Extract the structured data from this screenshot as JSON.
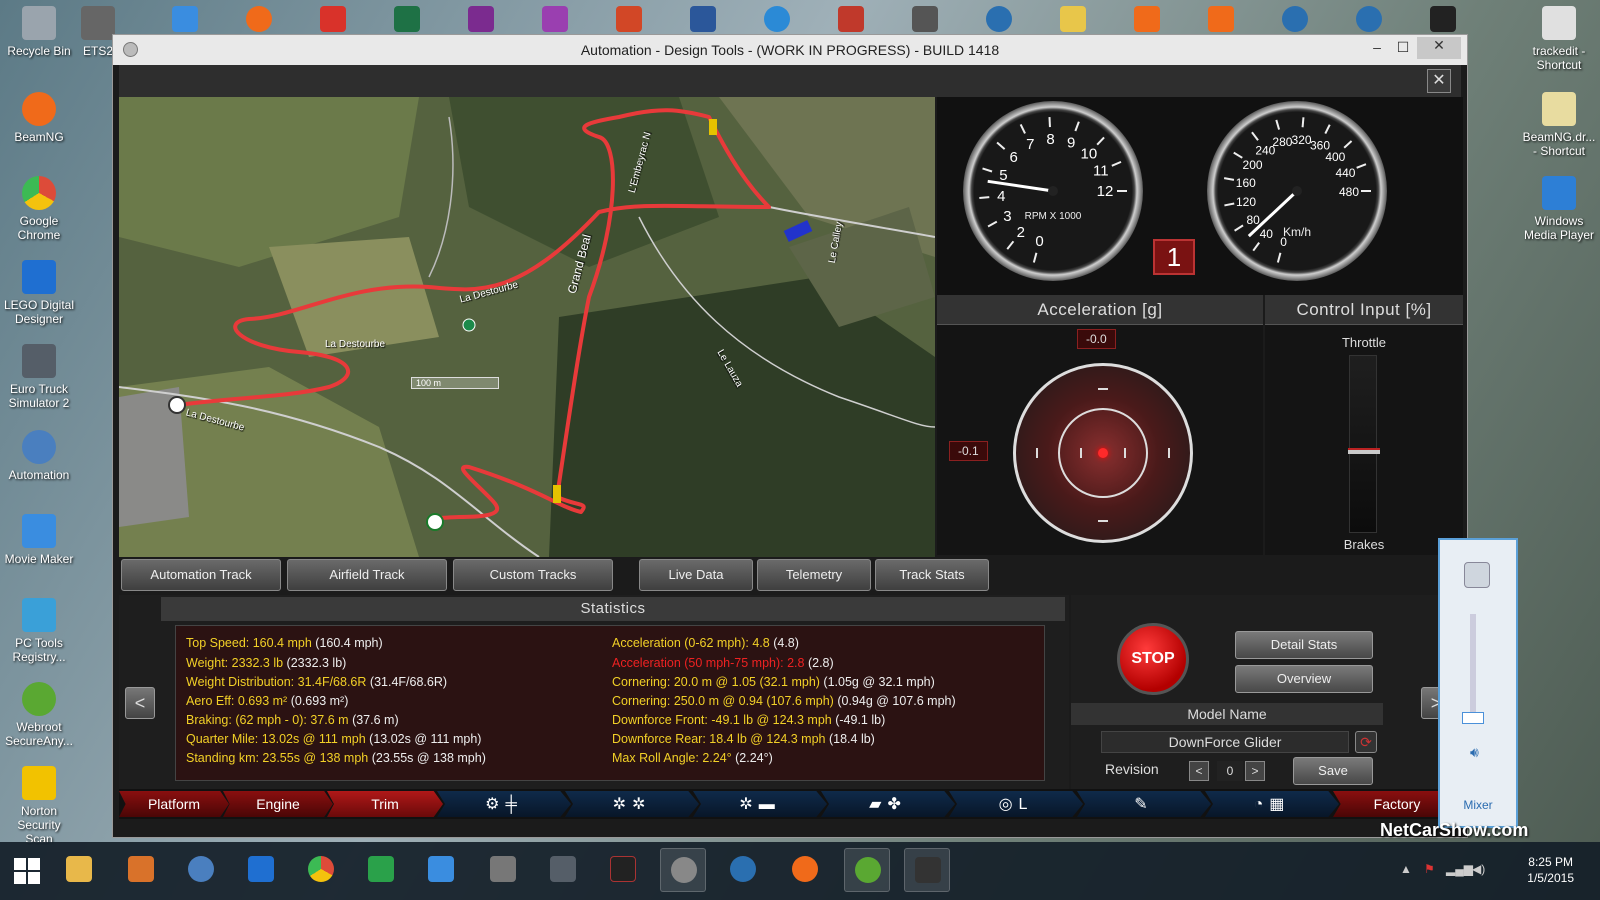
{
  "desktop": {
    "left_icons": [
      {
        "label": "Recycle Bin",
        "icon": "recycle-bin-icon",
        "color": "#9aa4ad"
      },
      {
        "label": "BeamNG",
        "icon": "beamng-icon",
        "color": "#f06a1a"
      },
      {
        "label": "Google Chrome",
        "icon": "chrome-icon",
        "color": "#dd4b39"
      },
      {
        "label": "LEGO Digital Designer",
        "icon": "lego-icon",
        "color": "#1f6fd1"
      },
      {
        "label": "Euro Truck Simulator 2",
        "icon": "truck-icon",
        "color": "#555e68"
      },
      {
        "label": "Automation",
        "icon": "automation-icon",
        "color": "#4a7fbf"
      },
      {
        "label": "Movie Maker",
        "icon": "movie-maker-icon",
        "color": "#3a8de0"
      },
      {
        "label": "PC Tools Registry...",
        "icon": "pc-tools-icon",
        "color": "#3aa0d8"
      },
      {
        "label": "Webroot SecureAny...",
        "icon": "webroot-icon",
        "color": "#5aa832"
      },
      {
        "label": "Norton Security Scan",
        "icon": "norton-icon",
        "color": "#f2c200"
      }
    ],
    "right_icons": [
      {
        "label": "trackedit - Shortcut",
        "icon": "trackedit-icon",
        "color": "#e0e0e0"
      },
      {
        "label": "BeamNG.dr... - Shortcut",
        "icon": "document-icon",
        "color": "#e8dca0"
      },
      {
        "label": "Windows Media Player",
        "icon": "media-player-icon",
        "color": "#2d7fd6"
      }
    ],
    "top_partial_label": "ETS2",
    "watermark": "NetCarShow.com"
  },
  "window": {
    "title": "Automation - Design Tools - (WORK IN PROGRESS) - BUILD 1418",
    "minimize": "–",
    "maximize": "☐",
    "close": "✕",
    "inner_close": "✕"
  },
  "map": {
    "labels": [
      "La Destourbe",
      "La Destourbe",
      "Grand Beal",
      "Le Calley",
      "Le Lauza",
      "L'Embeyrac N",
      "La Destourbe"
    ],
    "scale": "100 m"
  },
  "gauges": {
    "rpm": {
      "caption": "RPM X 1000",
      "ticks": [
        "0",
        "2",
        "3",
        "4",
        "5",
        "6",
        "7",
        "8",
        "9",
        "10",
        "11",
        "12"
      ],
      "value_rpm_x1000": 4.6
    },
    "speed": {
      "caption": "Km/h",
      "ticks": [
        "0",
        "40",
        "80",
        "120",
        "160",
        "200",
        "240",
        "280",
        "320",
        "360",
        "400",
        "440",
        "480"
      ],
      "value_kmh": 60
    },
    "gear": "1"
  },
  "acceleration": {
    "title": "Acceleration [g]",
    "longitudinal": "-0.0",
    "lateral": "-0.1"
  },
  "control_input": {
    "title": "Control Input [%]",
    "throttle_label": "Throttle",
    "brakes_label": "Brakes",
    "throttle_level": 0.46
  },
  "tabs": [
    {
      "label": "Automation Track"
    },
    {
      "label": "Airfield Track"
    },
    {
      "label": "Custom Tracks"
    },
    {
      "label": "Live Data"
    },
    {
      "label": "Telemetry"
    },
    {
      "label": "Track Stats"
    }
  ],
  "statistics": {
    "title": "Statistics",
    "left": [
      {
        "key": "Top Speed: 160.4 mph",
        "val": "(160.4 mph)"
      },
      {
        "key": "Weight: 2332.3 lb",
        "val": "(2332.3 lb)"
      },
      {
        "key": "Weight Distribution: 31.4F/68.6R",
        "val": "(31.4F/68.6R)"
      },
      {
        "key": "Aero Eff: 0.693 m²",
        "val": "(0.693 m²)"
      },
      {
        "key": "Braking: (62 mph - 0): 37.6 m",
        "val": "(37.6 m)"
      },
      {
        "key": "Quarter Mile: 13.02s @ 111 mph",
        "val": "(13.02s @ 111 mph)"
      },
      {
        "key": "Standing km: 23.55s @ 138 mph",
        "val": "(23.55s @ 138 mph)"
      }
    ],
    "right": [
      {
        "key": "Acceleration (0-62 mph): 4.8",
        "val": "(4.8)"
      },
      {
        "key": "Acceleration (50 mph-75 mph): 2.8",
        "val": "(2.8)"
      },
      {
        "key": "Cornering: 20.0 m @ 1.05 (32.1 mph)",
        "val": "(1.05g @ 32.1 mph)"
      },
      {
        "key": "Cornering: 250.0 m @ 0.94 (107.6 mph)",
        "val": "(0.94g @ 107.6 mph)"
      },
      {
        "key": "Downforce Front: -49.1 lb @ 124.3 mph",
        "val": "(-49.1 lb)"
      },
      {
        "key": "Downforce Rear: 18.4 lb @ 124.3 mph",
        "val": "(18.4 lb)"
      },
      {
        "key": "Max Roll Angle: 2.24°",
        "val": "(2.24°)"
      }
    ],
    "prev": "<",
    "next": ">"
  },
  "side": {
    "stop": "STOP",
    "detail_stats": "Detail Stats",
    "overview": "Overview",
    "model_name_label": "Model Name",
    "model_name": "DownForce Glider",
    "revision_label": "Revision",
    "revision": "0",
    "rev_prev": "<",
    "rev_next": ">",
    "save": "Save"
  },
  "bottom_nav": [
    {
      "label": "Platform"
    },
    {
      "label": "Engine"
    },
    {
      "label": "Trim"
    },
    {
      "label": "",
      "icon": "gear-shift-icon"
    },
    {
      "label": "",
      "icon": "wheels-icon"
    },
    {
      "label": "",
      "icon": "body-icon"
    },
    {
      "label": "",
      "icon": "aero-icon"
    },
    {
      "label": "",
      "icon": "interior-icon"
    },
    {
      "label": "",
      "icon": "tuning-icon"
    },
    {
      "label": "",
      "icon": "test-track-icon"
    },
    {
      "label": "Factory"
    }
  ],
  "mixer": {
    "label": "Mixer"
  },
  "taskbar": {
    "clock_time": "8:25 PM",
    "clock_date": "1/5/2015"
  },
  "colors": {
    "accent_red": "#b01818",
    "stat_key": "#f2d027",
    "stat_warn": "#e22222",
    "route": "#e83a3a"
  }
}
